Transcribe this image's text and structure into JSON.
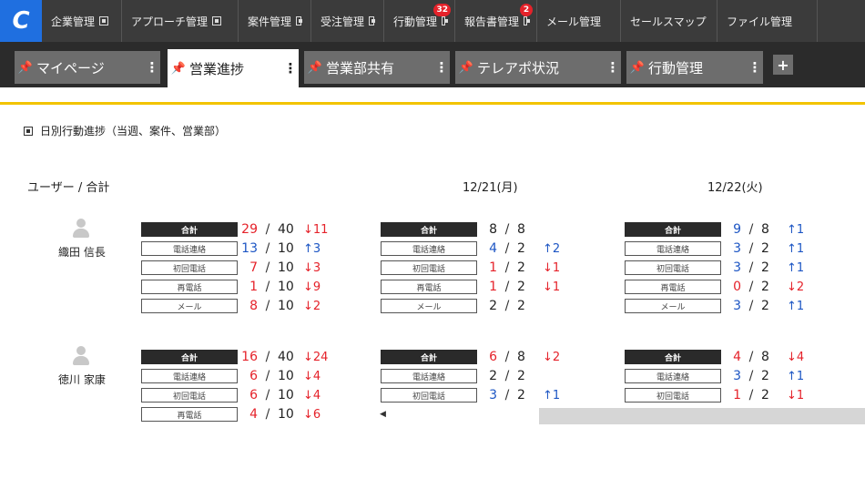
{
  "nav": {
    "logo": "C",
    "items": [
      {
        "label": "企業管理",
        "box": true,
        "badge": ""
      },
      {
        "label": "アプローチ管理",
        "box": true,
        "badge": ""
      },
      {
        "label": "案件管理",
        "box": true,
        "badge": ""
      },
      {
        "label": "受注管理",
        "box": true,
        "badge": ""
      },
      {
        "label": "行動管理",
        "box": true,
        "badge": "32"
      },
      {
        "label": "報告書管理",
        "box": true,
        "badge": "2"
      },
      {
        "label": "メール管理",
        "box": false,
        "badge": ""
      },
      {
        "label": "セールスマップ",
        "box": false,
        "badge": ""
      },
      {
        "label": "ファイル管理",
        "box": false,
        "badge": ""
      }
    ]
  },
  "tabs": [
    {
      "label": "マイページ",
      "pin": "📌",
      "dots": "⋮",
      "state": "pinned"
    },
    {
      "label": "営業進捗",
      "pin": "📌",
      "dots": "⋮",
      "state": "active"
    },
    {
      "label": "営業部共有",
      "pin": "📌",
      "dots": "⋮",
      "state": "dim"
    },
    {
      "label": "テレアポ状況",
      "pin": "📌",
      "dots": "⋮",
      "state": "dim"
    },
    {
      "label": "行動管理",
      "pin": "📌",
      "dots": "⋮",
      "state": "dim"
    }
  ],
  "tab_add": "+",
  "section_title": "日別行動進捗（当週、案件、営業部）",
  "columns": {
    "user_total": "ユーザー / 合計",
    "days": [
      "12/21(月)",
      "12/22(火)"
    ]
  },
  "users": [
    {
      "name": "織田 信長",
      "blocks": [
        [
          {
            "label": "合計",
            "v": "29",
            "t": "40",
            "d": "11",
            "dir": "down",
            "c": "red"
          },
          {
            "label": "電話連絡",
            "v": "13",
            "t": "10",
            "d": "3",
            "dir": "up",
            "c": "blue"
          },
          {
            "label": "初回電話",
            "v": "7",
            "t": "10",
            "d": "3",
            "dir": "down",
            "c": "red"
          },
          {
            "label": "再電話",
            "v": "1",
            "t": "10",
            "d": "9",
            "dir": "down",
            "c": "red"
          },
          {
            "label": "メール",
            "v": "8",
            "t": "10",
            "d": "2",
            "dir": "down",
            "c": "red"
          }
        ],
        [
          {
            "label": "合計",
            "v": "8",
            "t": "8",
            "d": "",
            "dir": "",
            "c": "blk"
          },
          {
            "label": "電話連絡",
            "v": "4",
            "t": "2",
            "d": "2",
            "dir": "up",
            "c": "blue"
          },
          {
            "label": "初回電話",
            "v": "1",
            "t": "2",
            "d": "1",
            "dir": "down",
            "c": "red"
          },
          {
            "label": "再電話",
            "v": "1",
            "t": "2",
            "d": "1",
            "dir": "down",
            "c": "red"
          },
          {
            "label": "メール",
            "v": "2",
            "t": "2",
            "d": "",
            "dir": "",
            "c": "blk"
          }
        ],
        [
          {
            "label": "合計",
            "v": "9",
            "t": "8",
            "d": "1",
            "dir": "up",
            "c": "blue"
          },
          {
            "label": "電話連絡",
            "v": "3",
            "t": "2",
            "d": "1",
            "dir": "up",
            "c": "blue"
          },
          {
            "label": "初回電話",
            "v": "3",
            "t": "2",
            "d": "1",
            "dir": "up",
            "c": "blue"
          },
          {
            "label": "再電話",
            "v": "0",
            "t": "2",
            "d": "2",
            "dir": "down",
            "c": "red"
          },
          {
            "label": "メール",
            "v": "3",
            "t": "2",
            "d": "1",
            "dir": "up",
            "c": "blue"
          }
        ]
      ]
    },
    {
      "name": "徳川 家康",
      "blocks": [
        [
          {
            "label": "合計",
            "v": "16",
            "t": "40",
            "d": "24",
            "dir": "down",
            "c": "red"
          },
          {
            "label": "電話連絡",
            "v": "6",
            "t": "10",
            "d": "4",
            "dir": "down",
            "c": "red"
          },
          {
            "label": "初回電話",
            "v": "6",
            "t": "10",
            "d": "4",
            "dir": "down",
            "c": "red"
          },
          {
            "label": "再電話",
            "v": "4",
            "t": "10",
            "d": "6",
            "dir": "down",
            "c": "red"
          }
        ],
        [
          {
            "label": "合計",
            "v": "6",
            "t": "8",
            "d": "2",
            "dir": "down",
            "c": "red"
          },
          {
            "label": "電話連絡",
            "v": "2",
            "t": "2",
            "d": "",
            "dir": "",
            "c": "blk"
          },
          {
            "label": "初回電話",
            "v": "3",
            "t": "2",
            "d": "1",
            "dir": "up",
            "c": "blue"
          }
        ],
        [
          {
            "label": "合計",
            "v": "4",
            "t": "8",
            "d": "4",
            "dir": "down",
            "c": "red"
          },
          {
            "label": "電話連絡",
            "v": "3",
            "t": "2",
            "d": "1",
            "dir": "up",
            "c": "blue"
          },
          {
            "label": "初回電話",
            "v": "1",
            "t": "2",
            "d": "1",
            "dir": "down",
            "c": "red"
          }
        ]
      ]
    }
  ],
  "scroll_left_arrow": "◀",
  "colors": {
    "accent_yellow": "#f2c300",
    "logo_blue": "#1f6fe0",
    "up_blue": "#1d56c4",
    "down_red": "#e5222a",
    "badge_red": "#e5222a"
  }
}
